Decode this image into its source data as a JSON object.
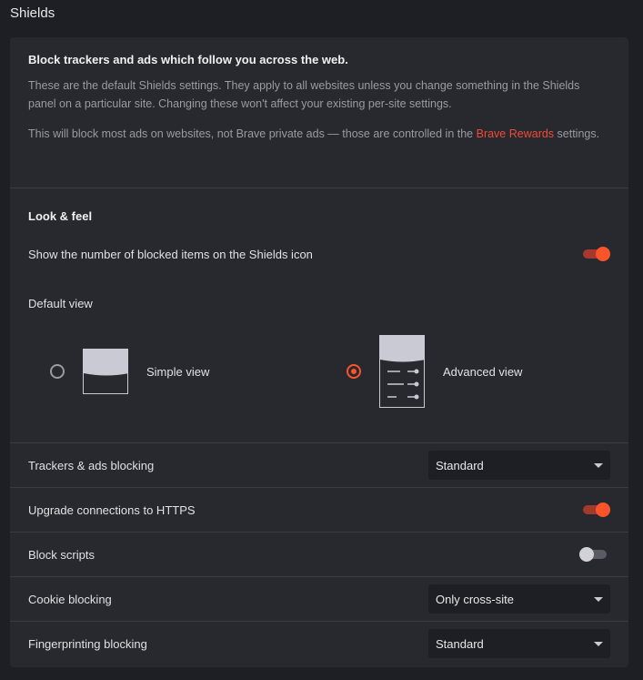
{
  "page": {
    "title": "Shields"
  },
  "intro": {
    "heading": "Block trackers and ads which follow you across the web.",
    "paragraph1": "These are the default Shields settings. They apply to all websites unless you change something in the Shields panel on a particular site. Changing these won't affect your existing per-site settings.",
    "paragraph2_before": "This will block most ads on websites, not Brave private ads — those are controlled in the ",
    "paragraph2_link": "Brave Rewards",
    "paragraph2_after": " settings."
  },
  "look_feel": {
    "title": "Look & feel",
    "show_blocked_count_label": "Show the number of blocked items on the Shields icon",
    "show_blocked_count_on": true,
    "default_view_label": "Default view",
    "options": [
      {
        "label": "Simple view",
        "selected": false
      },
      {
        "label": "Advanced view",
        "selected": true
      }
    ]
  },
  "settings": [
    {
      "label": "Trackers & ads blocking",
      "kind": "select",
      "value": "Standard"
    },
    {
      "label": "Upgrade connections to HTTPS",
      "kind": "toggle",
      "on": true
    },
    {
      "label": "Block scripts",
      "kind": "toggle",
      "on": false
    },
    {
      "label": "Cookie blocking",
      "kind": "select",
      "value": "Only cross-site"
    },
    {
      "label": "Fingerprinting blocking",
      "kind": "select",
      "value": "Standard"
    }
  ],
  "colors": {
    "accent": "#fb542b",
    "link": "#ef4b39",
    "card": "#28292e",
    "background": "#1e1f24"
  }
}
